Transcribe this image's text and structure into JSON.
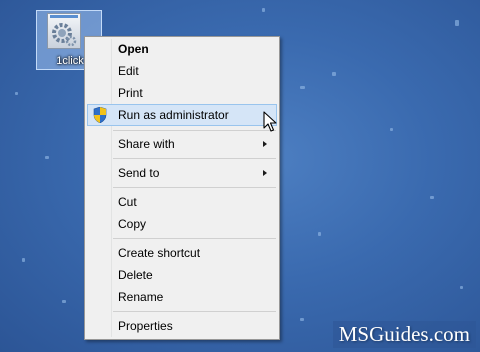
{
  "desktop": {
    "icon": {
      "label": "1click",
      "name": "gear-icon"
    }
  },
  "context_menu": {
    "items": [
      {
        "label": "Open",
        "bold": true
      },
      {
        "label": "Edit"
      },
      {
        "label": "Print"
      },
      {
        "label": "Run as administrator",
        "highlighted": true,
        "icon": "uac-shield-icon"
      },
      {
        "label": "Share with",
        "submenu": true
      },
      {
        "label": "Send to",
        "submenu": true
      },
      {
        "label": "Cut"
      },
      {
        "label": "Copy"
      },
      {
        "label": "Create shortcut"
      },
      {
        "label": "Delete"
      },
      {
        "label": "Rename"
      },
      {
        "label": "Properties"
      }
    ]
  },
  "watermark": {
    "text": "MSGuides.com"
  },
  "colors": {
    "desktop_bg": "#3a6aaf",
    "menu_bg": "#f0f0f0",
    "highlight_bg": "#d5e5f7",
    "highlight_border": "#99c4ed"
  }
}
